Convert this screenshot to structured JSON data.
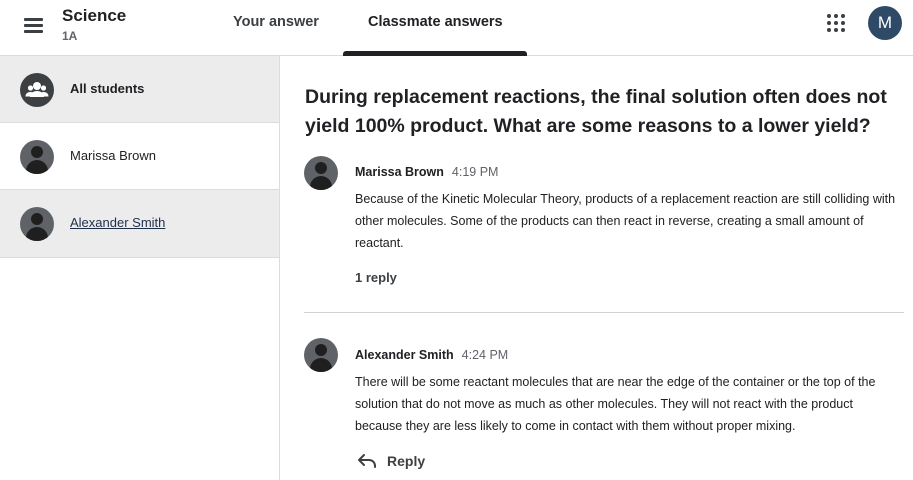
{
  "header": {
    "class_title": "Science",
    "class_section": "1A",
    "tabs": [
      {
        "label": "Your answer",
        "active": false
      },
      {
        "label": "Classmate answers",
        "active": true
      }
    ],
    "account_initial": "M",
    "account_color": "#2f4a66"
  },
  "sidebar": {
    "items": [
      {
        "label": "All students",
        "icon": "group-icon",
        "selected": true
      },
      {
        "label": "Marissa Brown",
        "icon": "avatar",
        "selected": false
      },
      {
        "label": "Alexander Smith",
        "icon": "avatar",
        "selected": true
      }
    ]
  },
  "question": {
    "text": "During replacement reactions, the final solution often does not yield 100% product. What are some reasons to a lower yield?"
  },
  "answers": [
    {
      "author": "Marissa Brown",
      "time": "4:19 PM",
      "text": "Because of the Kinetic Molecular Theory, products of a replacement reaction are still colliding with other molecules. Some of the products can then react in reverse, creating a small amount of reactant.",
      "replies_label": "1 reply"
    },
    {
      "author": "Alexander Smith",
      "time": "4:24 PM",
      "text": "There will be some reactant molecules that are near the edge of the container or the top of the solution that do not move as much as other molecules. They will not react with the product because they are less likely to come in contact with them without proper mixing.",
      "reply_label": "Reply"
    }
  ]
}
